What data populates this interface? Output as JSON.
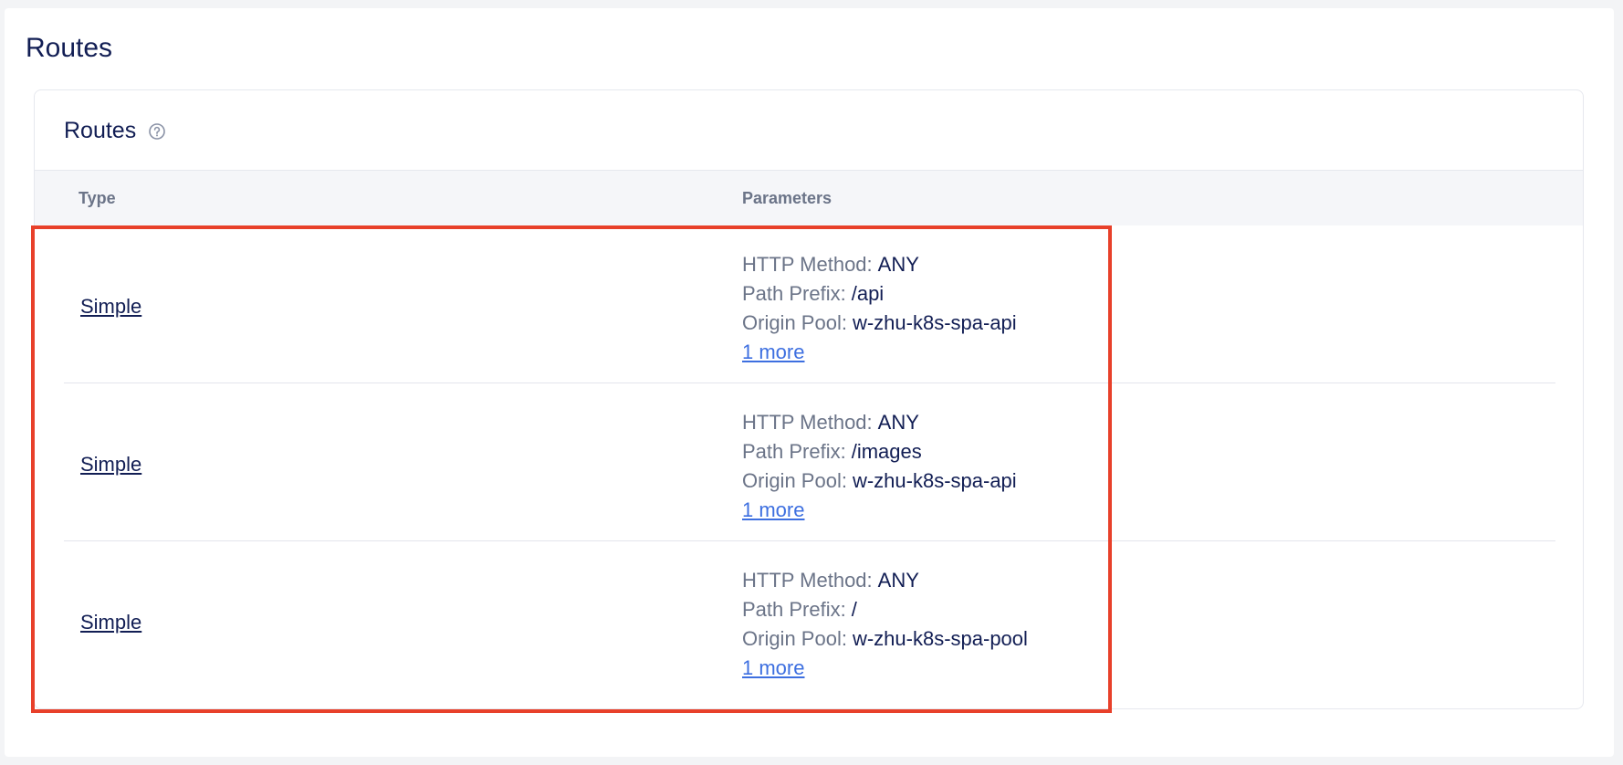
{
  "page": {
    "title": "Routes"
  },
  "section": {
    "title": "Routes",
    "help_icon": "question-circle-icon"
  },
  "table": {
    "headers": {
      "type": "Type",
      "parameters": "Parameters"
    },
    "rows": [
      {
        "type": "Simple",
        "params": [
          {
            "key": "HTTP Method:",
            "value": "ANY"
          },
          {
            "key": "Path Prefix:",
            "value": "/api"
          },
          {
            "key": "Origin Pool:",
            "value": "w-zhu-k8s-spa-api"
          }
        ],
        "more": "1 more"
      },
      {
        "type": "Simple",
        "params": [
          {
            "key": "HTTP Method:",
            "value": "ANY"
          },
          {
            "key": "Path Prefix:",
            "value": "/images"
          },
          {
            "key": "Origin Pool:",
            "value": "w-zhu-k8s-spa-api"
          }
        ],
        "more": "1 more"
      },
      {
        "type": "Simple",
        "params": [
          {
            "key": "HTTP Method:",
            "value": "ANY"
          },
          {
            "key": "Path Prefix:",
            "value": "/"
          },
          {
            "key": "Origin Pool:",
            "value": "w-zhu-k8s-spa-pool"
          }
        ],
        "more": "1 more"
      }
    ]
  },
  "colors": {
    "title": "#121e54",
    "muted": "#6b7488",
    "link": "#3d6fe0",
    "highlight": "#e8402a"
  }
}
